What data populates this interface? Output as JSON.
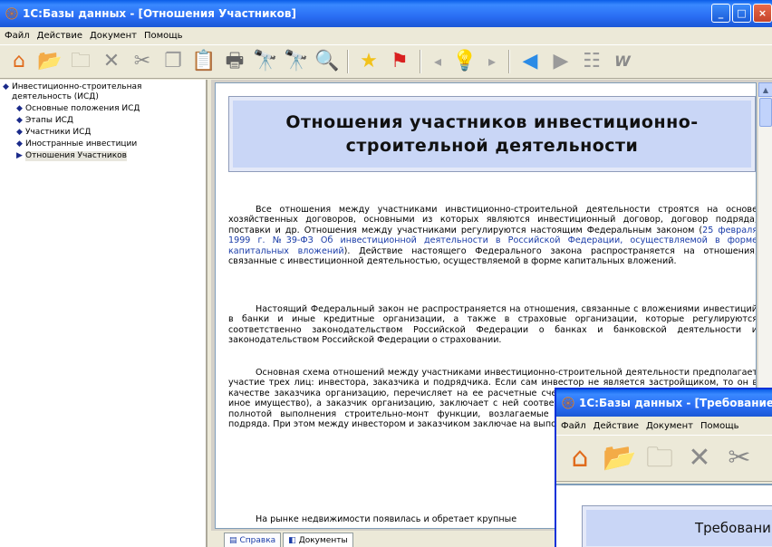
{
  "window": {
    "title": "1С:Базы данных - [Отношения Участников]",
    "menu": [
      "Файл",
      "Действие",
      "Документ",
      "Помощь"
    ]
  },
  "toolbar": {
    "icons": [
      "home-icon",
      "open-folder-icon",
      "new-folder-icon",
      "delete-icon",
      "cut-icon",
      "copy-icon",
      "paste-icon",
      "print-icon",
      "find-icon",
      "find-next-icon",
      "preview-icon",
      "favorite-icon",
      "flag-icon",
      "prev-small-icon",
      "bulb-icon",
      "next-small-icon",
      "back-icon",
      "forward-icon",
      "tree-icon",
      "word-icon"
    ]
  },
  "sidebar": {
    "root": "Инвестиционно-строительная деятельность (ИСД)",
    "items": [
      {
        "label": "Основные положения ИСД"
      },
      {
        "label": "Этапы ИСД"
      },
      {
        "label": "Участники ИСД"
      },
      {
        "label": "Иностранные инвестиции"
      },
      {
        "label": "Отношения Участников",
        "selected": true
      }
    ]
  },
  "document": {
    "heading": "Отношения участников инвестиционно-строительной деятельности",
    "p1_before": "Все отношения между участниками инвстиционно-строительной деятельности строятся на основе хозяйственных договоров, основными из которых являются инвестиционный договор, договор подряда, поставки и др. Отношения между участниками регулируются настоящим Федеральным законом (",
    "p1_link": "25 февраля 1999 г. №39-ФЗ  Об инвестиционной деятельности в Российской Федерации, осуществляемой в форме капитальных вложений",
    "p1_after": "). Действие настоящего Федерального закона распространяется на отношения, связанные с инвестиционной деятельностью, осуществляемой в форме капитальных вложений.",
    "p2": "Настоящий Федеральный закон не распространяется на отношения, связанные с вложениями инвестиций в банки и иные кредитные организации, а также в страховые организации, которые регулируются соответственно законодательством Российской Федерации о банках и банковской деятельности и законодательством Российской Федерации о страховании.",
    "p3": "Основная  схема отношений между участниками инвестиционно-строительной деятельности предполагает участие трех лиц: инвестора, заказчика и подрядчика. Если сам инвестор не является застройщиком, то он в качестве заказчика организацию, перечисляет на ее расчетные счета необходимы качестве финансирования иное имущество), а заказчик организацию, заключает с ней соответствующие договора, сроком, качеством и полнотой выполнения строительно-монт функции, возлагаемые на заказчика действующим законодате подряда. При этом между инвестором и заказчиком заключае на выполнение функций заказчика).",
    "p4": "На рынке недвижимости появилась и обретает крупные"
  },
  "tabs": [
    {
      "label": "Справка",
      "icon": "book-icon",
      "active": true
    },
    {
      "label": "Документы",
      "icon": "documents-icon",
      "active": false
    }
  ],
  "window2": {
    "title": "1С:Базы данных - [Требование з",
    "menu": [
      "Файл",
      "Действие",
      "Документ",
      "Помощь"
    ],
    "heading": "Требовани"
  }
}
